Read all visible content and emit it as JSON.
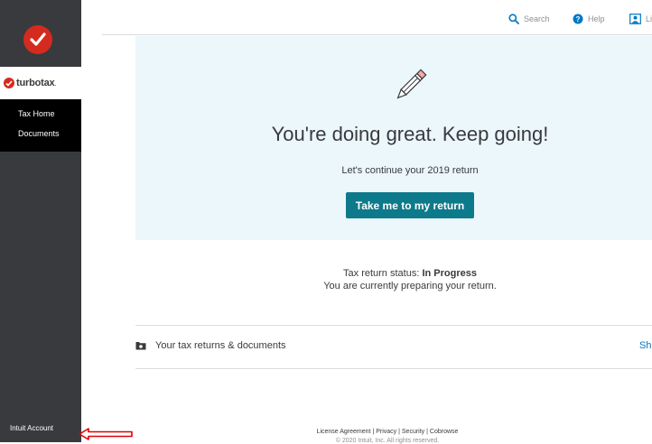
{
  "sidebar": {
    "brand_name": "turbotax",
    "brand_suffix": ".",
    "nav": [
      {
        "label": "Tax Home"
      },
      {
        "label": "Documents"
      }
    ],
    "account_label": "Intuit Account"
  },
  "topbar": {
    "search_label": "Search",
    "help_label": "Help",
    "profile_label": "Li"
  },
  "hero": {
    "title": "You're doing great. Keep going!",
    "subtitle": "Let's continue your 2019 return",
    "button_label": "Take me to my return"
  },
  "status": {
    "prefix": "Tax return status: ",
    "value": "In Progress",
    "detail": "You are currently preparing your return."
  },
  "returns_row": {
    "label": "Your tax returns & documents",
    "link_label": "Sh"
  },
  "footer": {
    "links": [
      "License Agreement",
      "Privacy",
      "Security",
      "Cobrowse"
    ],
    "separator": " | ",
    "copyright": "© 2020 Intuit, Inc. All rights reserved."
  },
  "colors": {
    "brand_red": "#d52b1e",
    "sidebar_bg": "#393a3d",
    "cta_teal": "#0d7a8c",
    "hero_bg": "#ecf7fb",
    "annotation_red": "#e00000"
  },
  "icons": {
    "logo": "checkmark-circle-icon",
    "search": "search-icon",
    "help": "help-icon",
    "profile": "profile-icon",
    "hero": "pencil-icon",
    "row": "folder-icon",
    "annotation": "arrow-left-icon"
  }
}
